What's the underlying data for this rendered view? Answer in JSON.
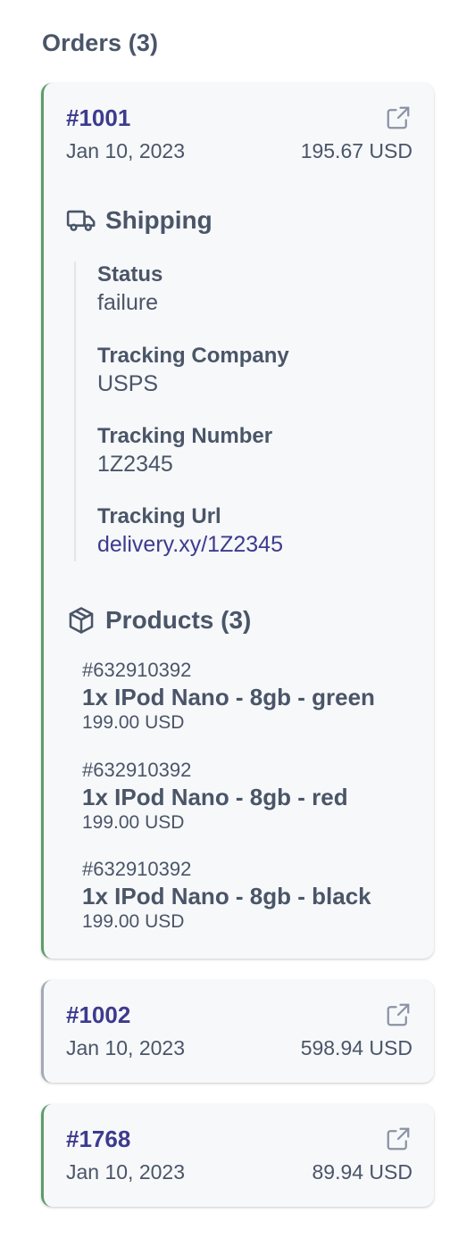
{
  "orders_title": "Orders (3)",
  "colors": {
    "accent_success": "#5a9e6a",
    "accent_neutral": "#a3a9b6",
    "link": "#3d3b8e",
    "text": "#4a5568"
  },
  "orders": [
    {
      "id": "#1001",
      "date": "Jan 10, 2023",
      "total": "195.67 USD",
      "status_color": "green",
      "shipping": {
        "title": "Shipping",
        "status_label": "Status",
        "status_value": "failure",
        "company_label": "Tracking Company",
        "company_value": "USPS",
        "number_label": "Tracking Number",
        "number_value": "1Z2345",
        "url_label": "Tracking Url",
        "url_value": "delivery.xy/1Z2345"
      },
      "products_title": "Products (3)",
      "products": [
        {
          "sku": "#632910392",
          "name": "1x IPod Nano - 8gb - green",
          "price": "199.00 USD"
        },
        {
          "sku": "#632910392",
          "name": "1x IPod Nano - 8gb - red",
          "price": "199.00 USD"
        },
        {
          "sku": "#632910392",
          "name": "1x IPod Nano - 8gb - black",
          "price": "199.00 USD"
        }
      ]
    },
    {
      "id": "#1002",
      "date": "Jan 10, 2023",
      "total": "598.94 USD",
      "status_color": "gray"
    },
    {
      "id": "#1768",
      "date": "Jan 10, 2023",
      "total": "89.94 USD",
      "status_color": "green"
    }
  ],
  "icons": {
    "external": "external-link-icon",
    "shipping": "truck-icon",
    "products": "package-icon"
  }
}
